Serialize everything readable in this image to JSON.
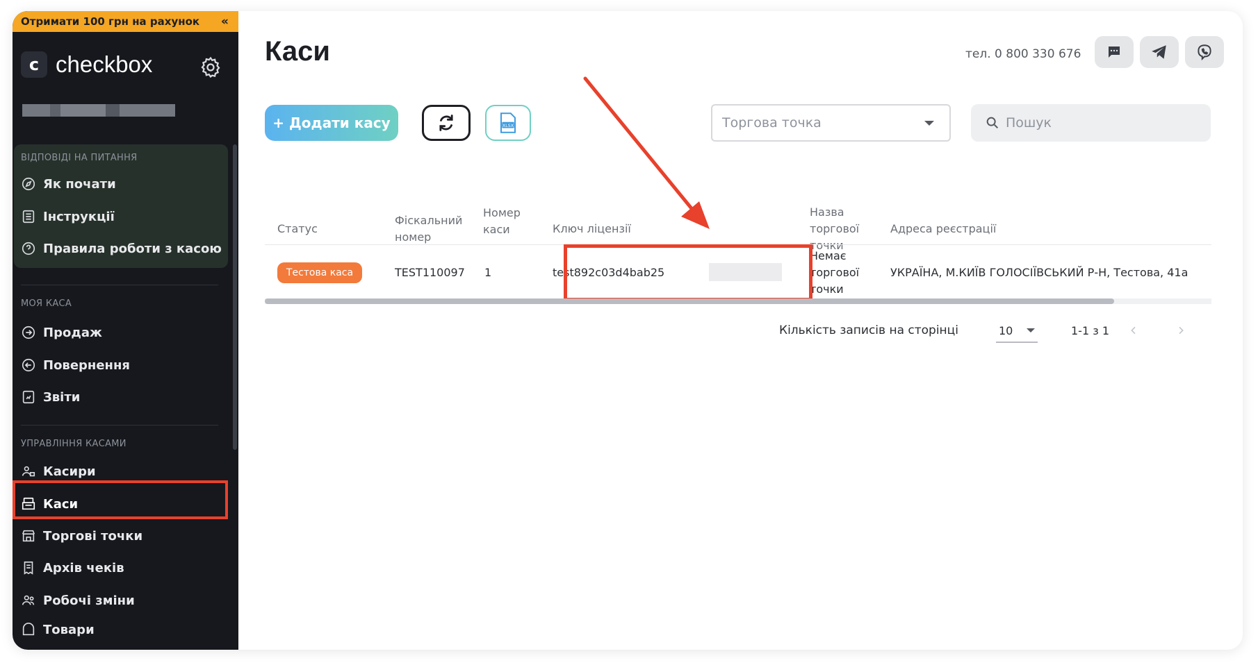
{
  "promo": {
    "text": "Отримати 100 грн на рахунок",
    "collapse": "«"
  },
  "brand": {
    "logo_letter": "c",
    "name": "checkbox"
  },
  "sidebar": {
    "sections": [
      {
        "title": "Відповіді на питання",
        "items": [
          {
            "label": "Як почати",
            "icon": "compass-icon"
          },
          {
            "label": "Інструкції",
            "icon": "document-icon"
          },
          {
            "label": "Правила роботи з касою",
            "icon": "question-icon"
          }
        ]
      },
      {
        "title": "Моя каса",
        "items": [
          {
            "label": "Продаж",
            "icon": "arrow-right-circle-icon"
          },
          {
            "label": "Повернення",
            "icon": "arrow-left-circle-icon"
          },
          {
            "label": "Звіти",
            "icon": "report-icon"
          }
        ]
      },
      {
        "title": "Управління касами",
        "items": [
          {
            "label": "Касири",
            "icon": "cashiers-icon"
          },
          {
            "label": "Каси",
            "icon": "cash-register-icon",
            "active": true
          },
          {
            "label": "Торгові точки",
            "icon": "store-icon"
          },
          {
            "label": "Архів чеків",
            "icon": "receipt-archive-icon"
          },
          {
            "label": "Робочі зміни",
            "icon": "users-icon"
          },
          {
            "label": "Товари",
            "icon": "goods-icon"
          }
        ]
      }
    ]
  },
  "header": {
    "title": "Каси",
    "phone": "тел. 0 800 330 676"
  },
  "toolbar": {
    "add_label": "+ Додати касу",
    "xlsx_label": "XLSX",
    "point_placeholder": "Торгова точка",
    "search_placeholder": "Пошук"
  },
  "table": {
    "headers": {
      "status": "Статус",
      "fiscal": [
        "Фіскальний",
        "номер"
      ],
      "number": [
        "Номер",
        "каси"
      ],
      "key": "Ключ ліцензії",
      "point": [
        "Назва",
        "торгової",
        "точки"
      ],
      "address": "Адреса реєстрації"
    },
    "rows": [
      {
        "status": "Тестова каса",
        "fiscal": "TEST110097",
        "number": "1",
        "key": "test892c03d4bab25",
        "point": [
          "Немає",
          "торгової",
          "точки"
        ],
        "address": "УКРАЇНА, М.КИЇВ ГОЛОСІЇВСЬКИЙ Р-Н, Тестова, 41а"
      }
    ]
  },
  "pagination": {
    "per_page_label": "Кількість записів на сторінці",
    "per_page_value": "10",
    "range": "1-1 з 1"
  },
  "colors": {
    "highlight": "#e8412c",
    "promo": "#f5a623",
    "badge": "#f27a3b",
    "sidebar": "#16181d"
  }
}
